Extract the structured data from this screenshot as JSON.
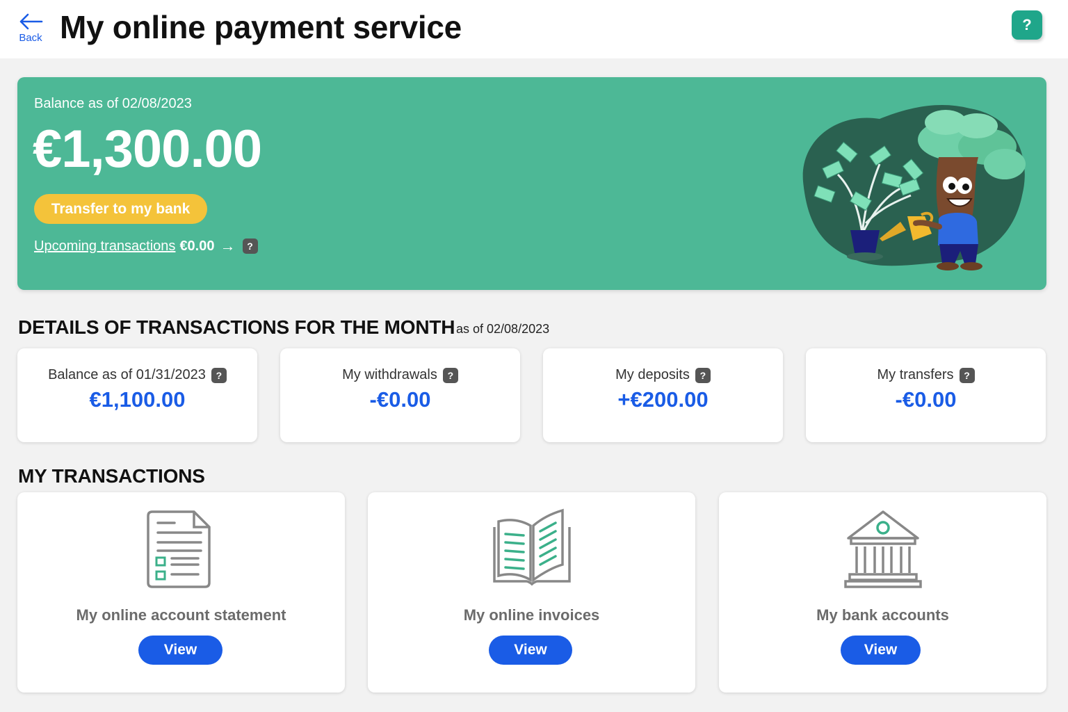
{
  "header": {
    "back_label": "Back",
    "title": "My online payment service",
    "help_label": "?"
  },
  "hero": {
    "balance_date": "Balance as of 02/08/2023",
    "balance_amount": "€1,300.00",
    "transfer_label": "Transfer to my bank",
    "upcoming_label": "Upcoming transactions",
    "upcoming_amount": "€0.00",
    "upcoming_arrow": "→",
    "help_label": "?"
  },
  "details": {
    "title": "DETAILS OF TRANSACTIONS FOR THE MONTH",
    "as_of": "as of 02/08/2023",
    "cards": [
      {
        "label": "Balance as of 01/31/2023",
        "value": "€1,100.00",
        "help": "?"
      },
      {
        "label": "My withdrawals",
        "value": "-€0.00",
        "help": "?"
      },
      {
        "label": "My deposits",
        "value": "+€200.00",
        "help": "?"
      },
      {
        "label": "My transfers",
        "value": "-€0.00",
        "help": "?"
      }
    ]
  },
  "transactions": {
    "title": "MY TRANSACTIONS",
    "cards": [
      {
        "label": "My online account statement",
        "button": "View",
        "icon": "document-checklist-icon"
      },
      {
        "label": "My online invoices",
        "button": "View",
        "icon": "open-book-icon"
      },
      {
        "label": "My bank accounts",
        "button": "View",
        "icon": "bank-building-icon"
      }
    ]
  },
  "colors": {
    "brand_green": "#4db896",
    "accent_yellow": "#f4c33a",
    "primary_blue": "#1a5ce6",
    "help_green": "#1fa68a"
  }
}
